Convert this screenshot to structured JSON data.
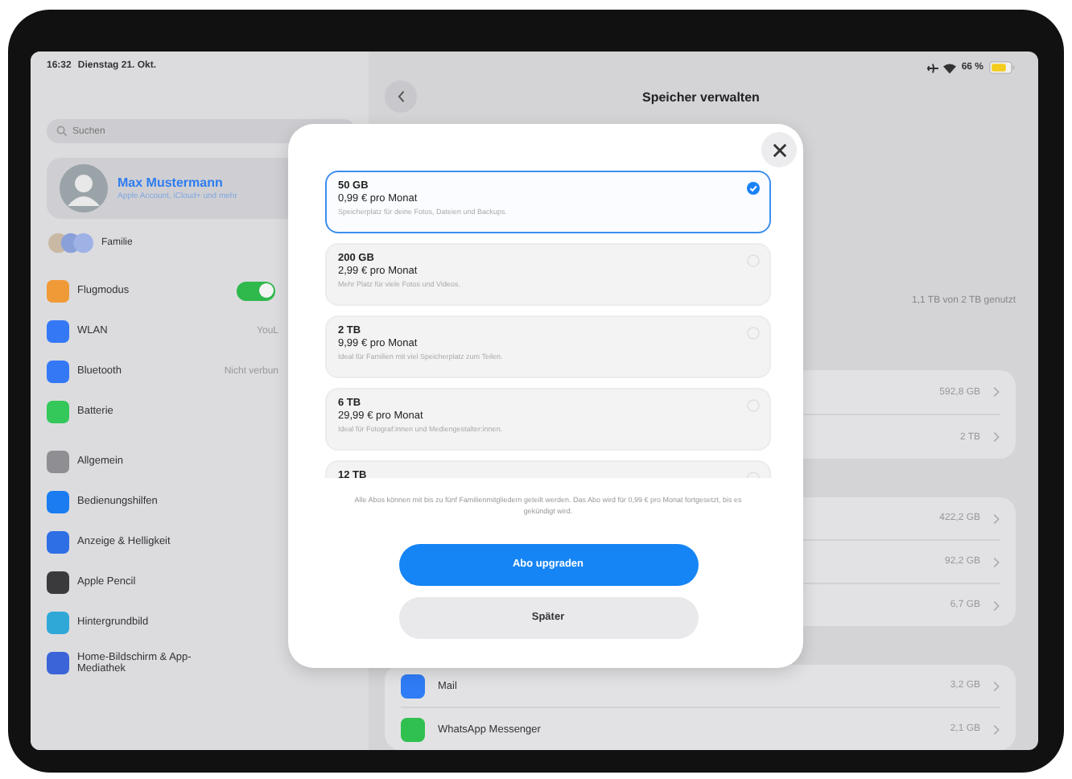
{
  "status_bar": {
    "time": "16:32",
    "date": "Dienstag 21. Okt.",
    "battery": "66 %"
  },
  "sidebar": {
    "search": {
      "placeholder": "Suchen"
    },
    "profile": {
      "name": "Max Mustermann",
      "subtitle": "Apple Account, iCloud+ und mehr"
    },
    "family": {
      "label": "Familie"
    },
    "groups": [
      {
        "items": [
          {
            "kind": "toggle",
            "label": "Flugmodus",
            "color": "#f09a37",
            "on": true
          },
          {
            "kind": "value",
            "label": "WLAN",
            "value": "YouL",
            "color": "#3478f6"
          },
          {
            "kind": "value",
            "label": "Bluetooth",
            "value": "Nicht verbun",
            "color": "#3478f6"
          },
          {
            "kind": "plain",
            "label": "Batterie",
            "color": "#34c759"
          }
        ]
      },
      {
        "items": [
          {
            "kind": "plain",
            "label": "Allgemein",
            "color": "#8e8e93"
          },
          {
            "kind": "plain",
            "label": "Bedienungshilfen",
            "color": "#1a7cf0"
          },
          {
            "kind": "plain",
            "label": "Anzeige & Helligkeit",
            "color": "#2f6fe6"
          },
          {
            "kind": "plain",
            "label": "Apple Pencil",
            "color": "#3a3a3c"
          },
          {
            "kind": "plain",
            "label": "Hintergrundbild",
            "color": "#2fa8d8"
          },
          {
            "kind": "plain",
            "label": "Home-Bildschirm & App-Mediathek",
            "color": "#3a64d8"
          }
        ]
      }
    ]
  },
  "detail": {
    "title": "Speicher verwalten",
    "usage": "1,1 TB von 2 TB genutzt",
    "sections": [
      {
        "rows": [
          {
            "value": "592,8 GB"
          },
          {
            "value": "2 TB"
          }
        ]
      },
      {
        "rows": [
          {
            "value": "422,2 GB"
          },
          {
            "value": "92,2 GB"
          },
          {
            "value": "6,7 GB"
          }
        ]
      },
      {
        "rows": [
          {
            "app": "Mail",
            "value": "3,2 GB",
            "color": "#2f7cf6"
          },
          {
            "app": "WhatsApp Messenger",
            "value": "2,1 GB",
            "color": "#30c04f"
          }
        ]
      }
    ]
  },
  "modal": {
    "plans": [
      {
        "title": "50 GB",
        "price": "0,99 € pro Monat",
        "description": "Speicherplatz für deine Fotos, Dateien und Backups.",
        "selected": true
      },
      {
        "title": "200 GB",
        "price": "2,99 € pro Monat",
        "description": "Mehr Platz für viele Fotos und Videos.",
        "selected": false
      },
      {
        "title": "2 TB",
        "price": "9,99 € pro Monat",
        "description": "Ideal für Familien mit viel Speicherplatz zum Teilen.",
        "selected": false
      },
      {
        "title": "6 TB",
        "price": "29,99 € pro Monat",
        "description": "Ideal für Fotograf:innen und Mediengestalter:innen.",
        "selected": false
      },
      {
        "title": "12 TB",
        "selected": false
      }
    ],
    "note": "Alle Abos können mit bis zu fünf Familienmitgliedern geteilt werden. Das Abo wird für 0,99 € pro Monat fortgesetzt, bis es gekündigt wird.",
    "buttons": [
      {
        "kind": "primary",
        "label": "Abo upgraden"
      },
      {
        "kind": "secondary",
        "label": "Später"
      }
    ]
  }
}
